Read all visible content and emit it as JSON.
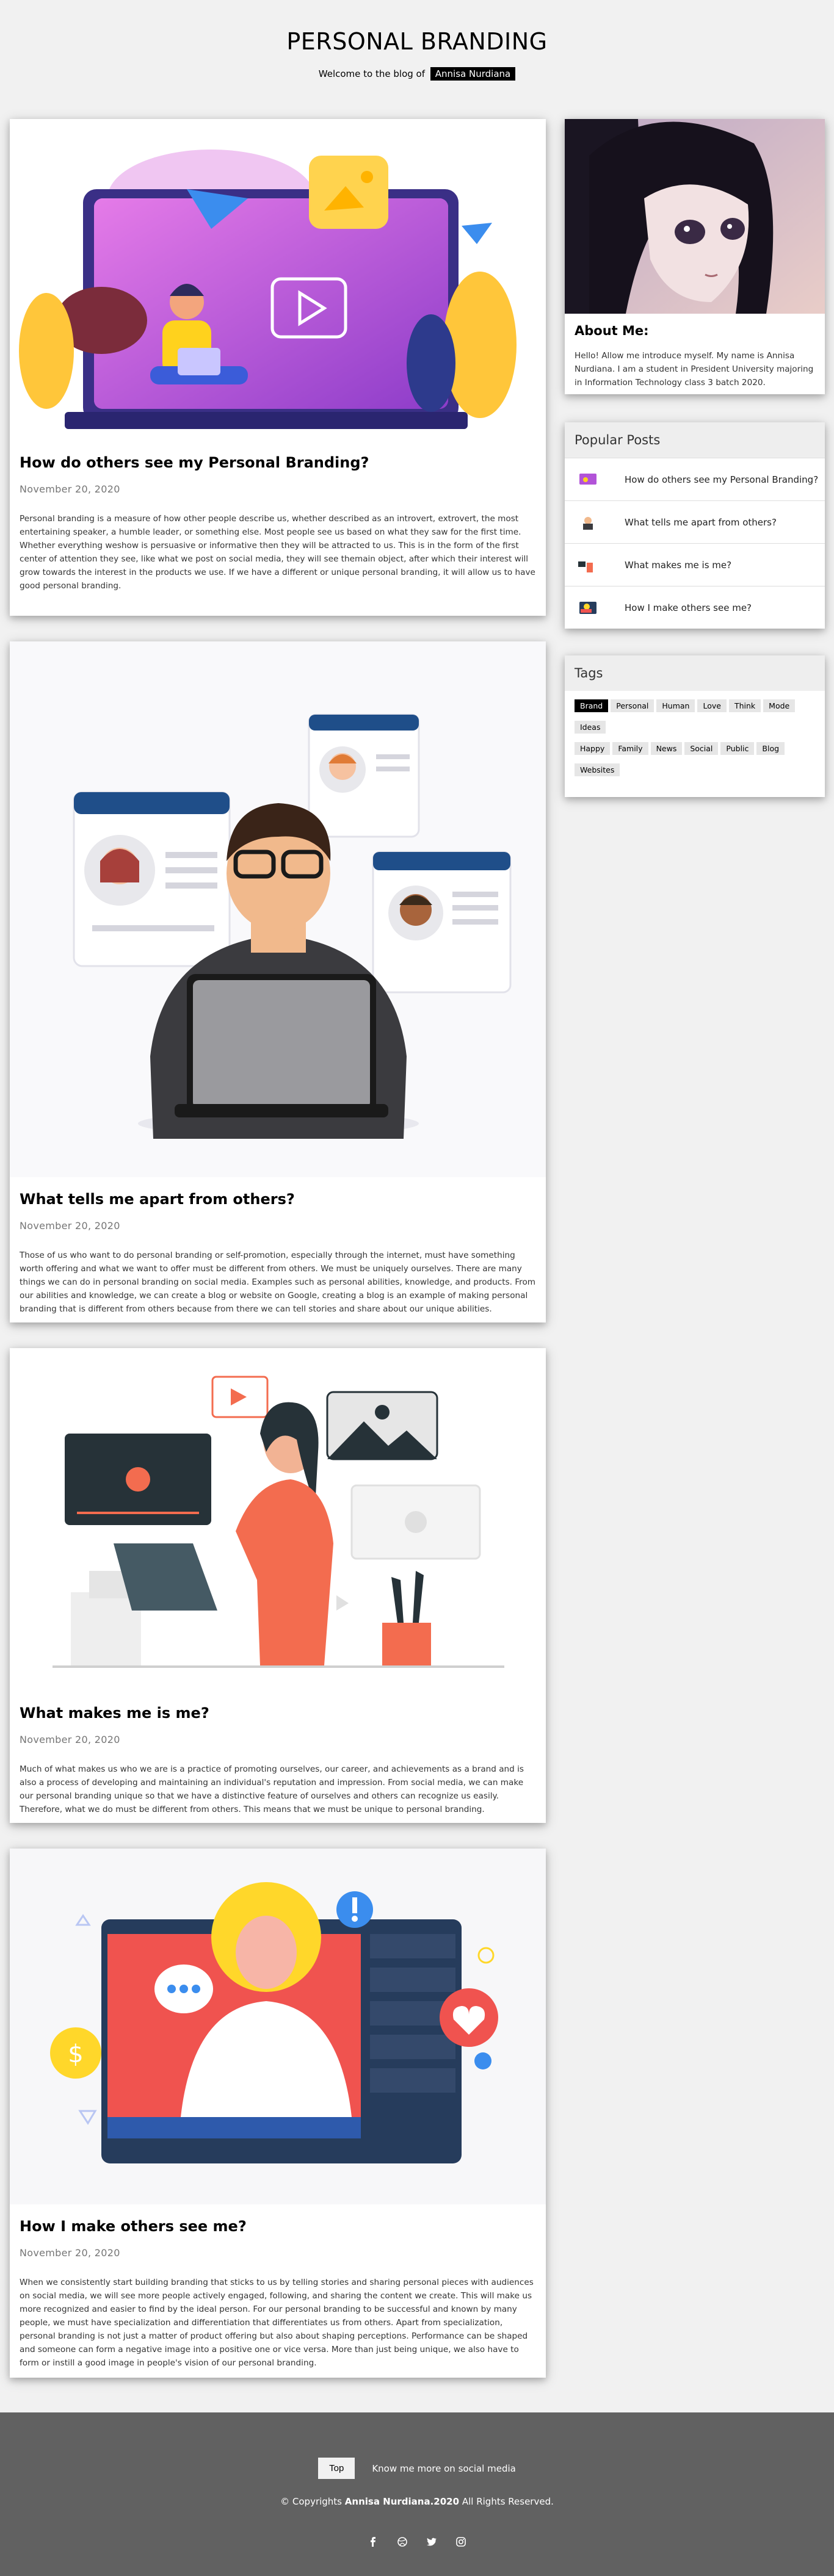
{
  "header": {
    "title": "PERSONAL BRANDING",
    "subtitle_prefix": "Welcome to the blog of",
    "author": "Annisa Nurdiana"
  },
  "posts": [
    {
      "title": "How do others see my Personal Branding?",
      "date": "November 20, 2020",
      "text": "Personal branding is a measure of how other people describe us, whether described as an introvert, extrovert, the most entertaining speaker, a humble leader, or something else. Most people see us based on what they saw for the first time. Whether everything weshow is persuasive or informative then they will be attracted to us. This is in the form of the first center of attention they see, like what we post on social media, they will see themain object, after which their interest will grow towards the interest in the products we use. If we have a different or unique personal branding, it will allow us to have good personal branding."
    },
    {
      "title": "What tells me apart from others?",
      "date": "November 20, 2020",
      "text": "Those of us who want to do personal branding or self-promotion, especially through the internet, must have something worth offering and what we want to offer must be different from others. We must be uniquely ourselves. There are many things we can do in personal branding on social media. Examples such as personal abilities, knowledge, and products. From our abilities and knowledge, we can create a blog or website on Google, creating a blog is an example of making personal branding that is different from others because from there we can tell stories and share about our unique abilities."
    },
    {
      "title": "What makes me is me?",
      "date": "November 20, 2020",
      "text": "Much of what makes us who we are is a practice of promoting ourselves, our career, and achievements as a brand and is also a process of developing and maintaining an individual's reputation and impression. From social media, we can make our personal branding unique so that we have a distinctive feature of ourselves and others can recognize us easily. Therefore, what we do must be different from others. This means that we must be unique to personal branding."
    },
    {
      "title": "How I make others see me?",
      "date": "November 20, 2020",
      "text": "When we consistently start building branding that sticks to us by telling stories and sharing personal pieces with audiences on social media, we will see more people actively engaged, following, and sharing the content we create. This will make us more recognized and easier to find by the ideal person. For our personal branding to be successful and known by many people, we must have specialization and differentiation that differentiates us from others. Apart from specialization, personal branding is not just a matter of product offering but also about shaping perceptions. Performance can be shaped and someone can form a negative image into a positive one or vice versa. More than just being unique, we also have to form or instill a good image in people's vision of our personal branding."
    }
  ],
  "about": {
    "title": "About Me:",
    "text": "Hello! Allow me introduce myself. My name is Annisa Nurdiana. I am a student in President University majoring in Information Technology class 3 batch 2020."
  },
  "popular": {
    "title": "Popular Posts",
    "items": [
      "How do others see my Personal Branding?",
      "What tells me apart from others?",
      "What makes me is me?",
      "How I make others see me?"
    ]
  },
  "tags": {
    "title": "Tags",
    "items": [
      "Brand",
      "Personal",
      "Human",
      "Love",
      "Think",
      "Mode",
      "Ideas",
      "Happy",
      "Family",
      "News",
      "Social",
      "Public",
      "Blog",
      "Websites"
    ]
  },
  "footer": {
    "top_label": "Top",
    "social_text": "Know me more on social media",
    "copy_prefix": "© Copyrights",
    "copy_name": "Annisa Nurdiana.2020",
    "copy_suffix": "All Rights Reserved.",
    "social_icons": [
      "facebook-icon",
      "dribbble-icon",
      "twitter-icon",
      "instagram-icon"
    ]
  },
  "colors": {
    "page_bg": "#f1f1f1",
    "footer_bg": "#616161",
    "accent_black": "#000000"
  }
}
